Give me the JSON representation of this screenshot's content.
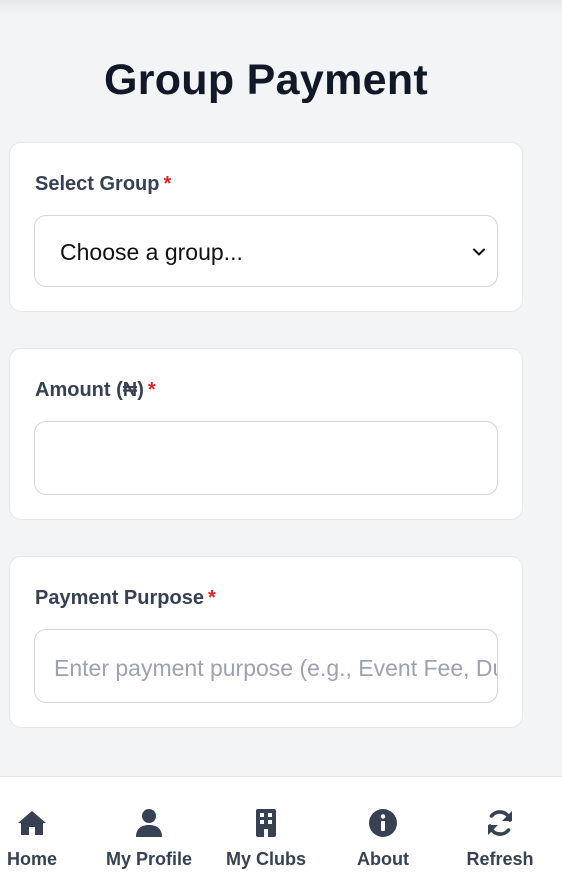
{
  "page": {
    "title": "Group Payment"
  },
  "form": {
    "group": {
      "label": "Select Group",
      "required_mark": "*",
      "selected": "Choose a group..."
    },
    "amount": {
      "label": "Amount (₦)",
      "required_mark": "*",
      "value": ""
    },
    "purpose": {
      "label": "Payment Purpose",
      "required_mark": "*",
      "placeholder": "Enter payment purpose (e.g., Event Fee, Dues)"
    }
  },
  "nav": {
    "items": [
      {
        "label": "Home",
        "icon": "home-icon"
      },
      {
        "label": "My Profile",
        "icon": "user-icon"
      },
      {
        "label": "My Clubs",
        "icon": "building-icon"
      },
      {
        "label": "About",
        "icon": "info-icon"
      },
      {
        "label": "Refresh",
        "icon": "refresh-icon"
      }
    ]
  },
  "colors": {
    "required": "#dc2626",
    "text": "#374151",
    "background": "#f3f4f6"
  }
}
